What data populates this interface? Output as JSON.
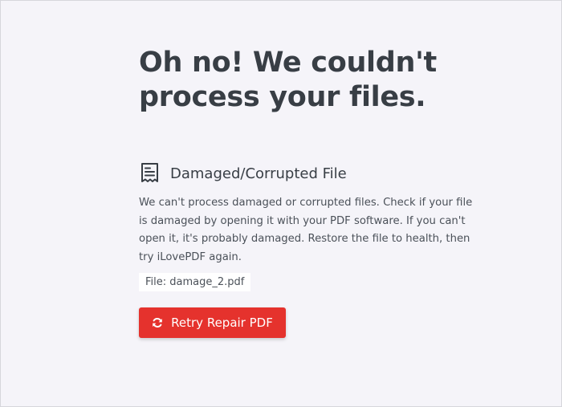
{
  "headline": "Oh no! We couldn't process your files.",
  "error": {
    "icon": "receipt-document-icon",
    "title": "Damaged/Corrupted File",
    "description": "We can't process damaged or corrupted files. Check if your file is damaged by opening it with your PDF software. If you can't open it, it's probably damaged. Restore the file to health, then try iLovePDF again.",
    "file_label": "File: damage_2.pdf"
  },
  "retry_button": {
    "icon": "refresh-icon",
    "label": "Retry Repair PDF"
  },
  "colors": {
    "background": "#f5f4f9",
    "text": "#383e45",
    "accent": "#e5322d"
  }
}
